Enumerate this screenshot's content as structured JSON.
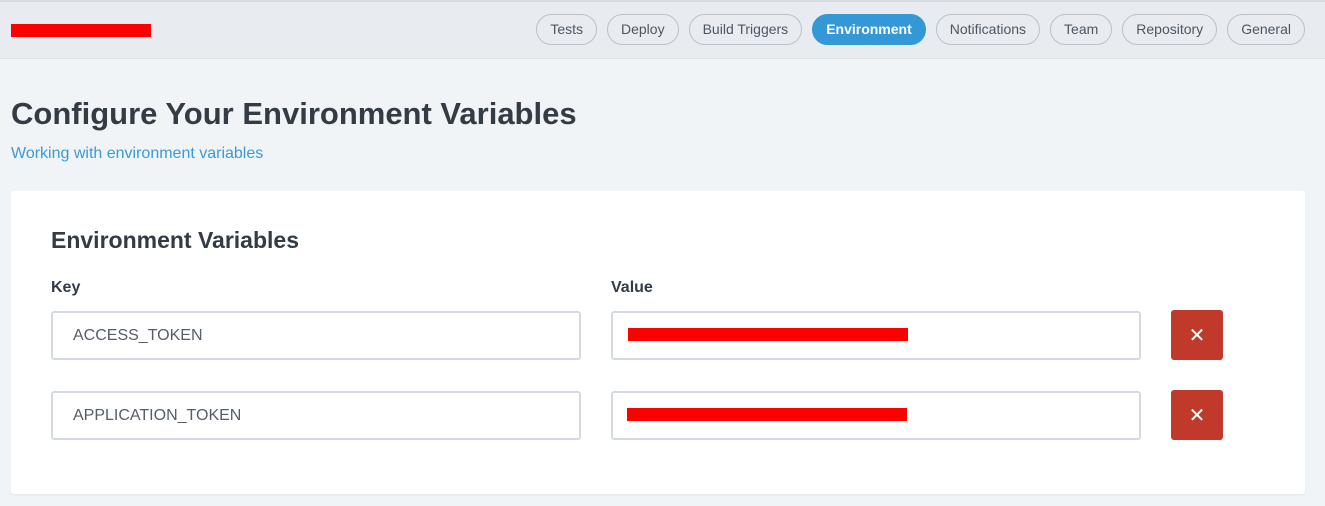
{
  "header": {
    "tabs": [
      {
        "label": "Tests",
        "active": false
      },
      {
        "label": "Deploy",
        "active": false
      },
      {
        "label": "Build Triggers",
        "active": false
      },
      {
        "label": "Environment",
        "active": true
      },
      {
        "label": "Notifications",
        "active": false
      },
      {
        "label": "Team",
        "active": false
      },
      {
        "label": "Repository",
        "active": false
      },
      {
        "label": "General",
        "active": false
      }
    ]
  },
  "page": {
    "title": "Configure Your Environment Variables",
    "help_link": "Working with environment variables"
  },
  "env_card": {
    "title": "Environment Variables",
    "key_header": "Key",
    "value_header": "Value",
    "delete_icon": "close-icon",
    "rows": [
      {
        "key": "ACCESS_TOKEN"
      },
      {
        "key": "APPLICATION_TOKEN"
      }
    ]
  },
  "colors": {
    "accent": "#3497d6",
    "danger": "#c0392b",
    "redaction": "#ff0000"
  }
}
